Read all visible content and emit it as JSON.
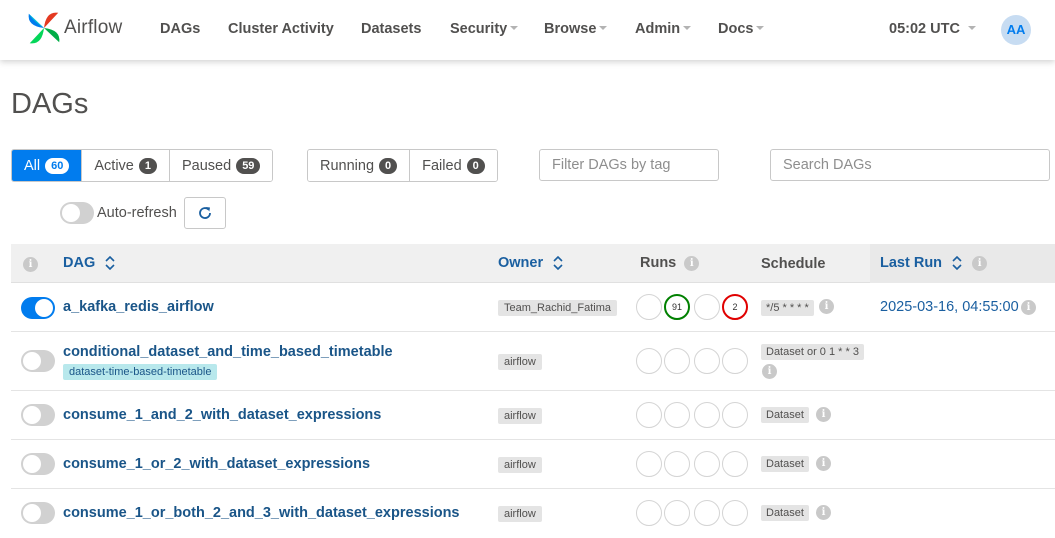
{
  "navbar": {
    "brand": "Airflow",
    "items": [
      {
        "label": "DAGs",
        "dropdown": false
      },
      {
        "label": "Cluster Activity",
        "dropdown": false
      },
      {
        "label": "Datasets",
        "dropdown": false
      },
      {
        "label": "Security",
        "dropdown": true
      },
      {
        "label": "Browse",
        "dropdown": true
      },
      {
        "label": "Admin",
        "dropdown": true
      },
      {
        "label": "Docs",
        "dropdown": true
      }
    ],
    "time": "05:02 UTC",
    "avatar": "AA"
  },
  "page_title": "DAGs",
  "filters": {
    "status": [
      {
        "label": "All",
        "count": "60",
        "active": true
      },
      {
        "label": "Active",
        "count": "1",
        "active": false
      },
      {
        "label": "Paused",
        "count": "59",
        "active": false
      }
    ],
    "state": [
      {
        "label": "Running",
        "count": "0"
      },
      {
        "label": "Failed",
        "count": "0"
      }
    ],
    "tag_placeholder": "Filter DAGs by tag",
    "search_placeholder": "Search DAGs"
  },
  "auto_refresh": {
    "label": "Auto-refresh",
    "enabled": false
  },
  "table": {
    "columns": {
      "dag": "DAG",
      "owner": "Owner",
      "runs": "Runs",
      "schedule": "Schedule",
      "last_run": "Last Run"
    },
    "rows": [
      {
        "enabled": true,
        "name": "a_kafka_redis_airflow",
        "tag": "",
        "owner": "Team_Rachid_Fatima",
        "runs": [
          "",
          "91",
          "",
          "2"
        ],
        "schedule": "*/5 * * * *",
        "last_run": "2025-03-16, 04:55:00"
      },
      {
        "enabled": false,
        "name": "conditional_dataset_and_time_based_timetable",
        "tag": "dataset-time-based-timetable",
        "owner": "airflow",
        "runs": [
          "",
          "",
          "",
          ""
        ],
        "schedule": "Dataset or 0 1 * * 3",
        "last_run": ""
      },
      {
        "enabled": false,
        "name": "consume_1_and_2_with_dataset_expressions",
        "tag": "",
        "owner": "airflow",
        "runs": [
          "",
          "",
          "",
          ""
        ],
        "schedule": "Dataset",
        "last_run": ""
      },
      {
        "enabled": false,
        "name": "consume_1_or_2_with_dataset_expressions",
        "tag": "",
        "owner": "airflow",
        "runs": [
          "",
          "",
          "",
          ""
        ],
        "schedule": "Dataset",
        "last_run": ""
      },
      {
        "enabled": false,
        "name": "consume_1_or_both_2_and_3_with_dataset_expressions",
        "tag": "",
        "owner": "airflow",
        "runs": [
          "",
          "",
          "",
          ""
        ],
        "schedule": "Dataset",
        "last_run": ""
      }
    ]
  },
  "colors": {
    "accent": "#017cee",
    "success": "#008000",
    "failed": "#e00000"
  }
}
